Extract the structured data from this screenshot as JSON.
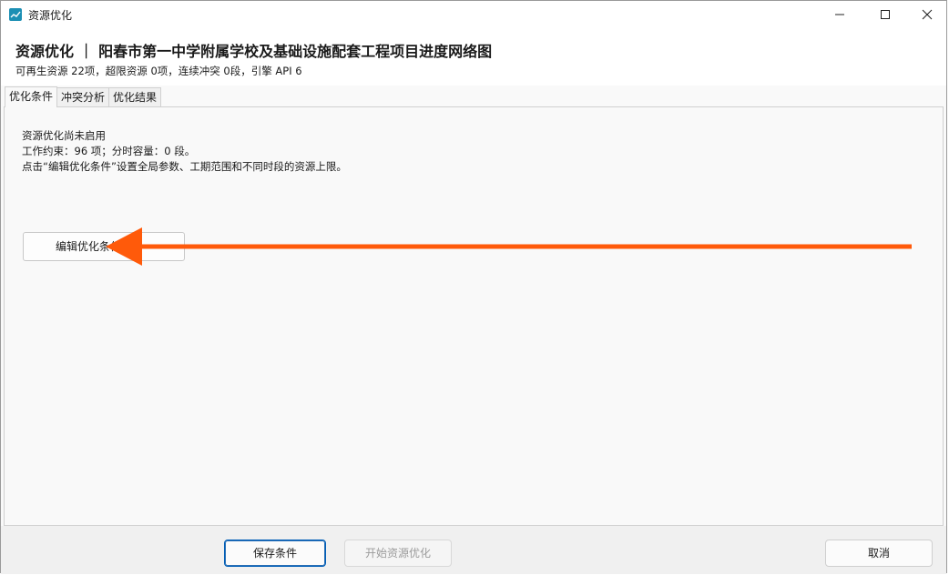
{
  "window": {
    "title": "资源优化"
  },
  "header": {
    "title": "资源优化 ｜ 阳春市第一中学附属学校及基础设施配套工程项目进度网络图",
    "subtitle": "可再生资源 22项，超限资源 0项，连续冲突 0段，引擎 API 6"
  },
  "tabs": [
    {
      "label": "优化条件",
      "active": true
    },
    {
      "label": "冲突分析",
      "active": false
    },
    {
      "label": "优化结果",
      "active": false
    }
  ],
  "panel": {
    "status": "资源优化尚未启用",
    "constraints": "工作约束：96 项；分时容量：0 段。",
    "hint": "点击“编辑优化条件”设置全局参数、工期范围和不同时段的资源上限。",
    "edit_button_label": "编辑优化条件"
  },
  "footer": {
    "save_label": "保存条件",
    "start_label": "开始资源优化",
    "cancel_label": "取消"
  },
  "annotation": {
    "arrow_color": "#ff5a0a"
  }
}
